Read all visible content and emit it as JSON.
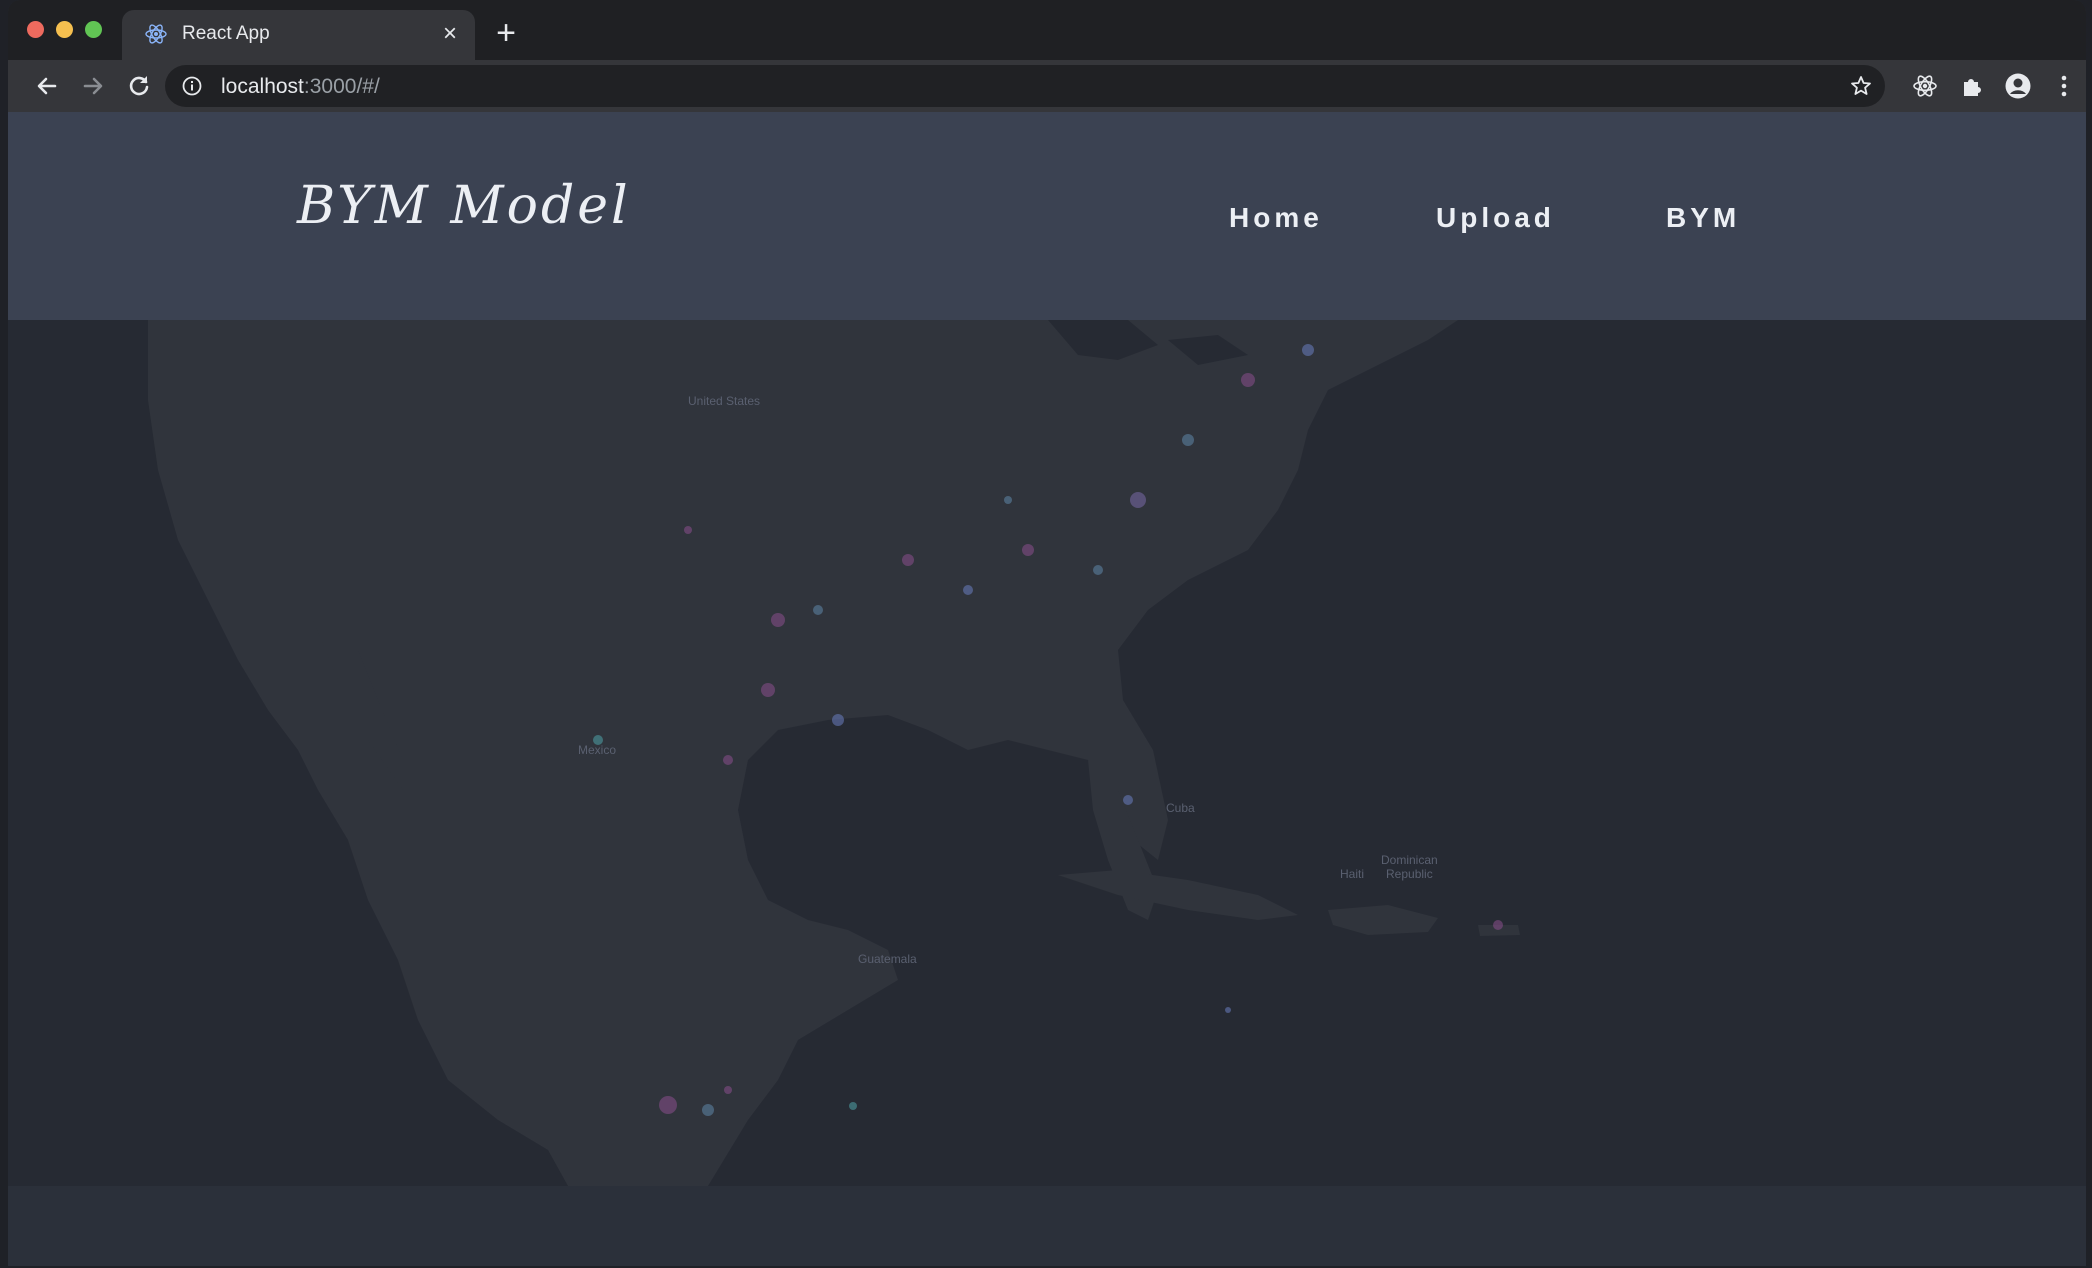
{
  "browser": {
    "tab_title": "React App",
    "close_glyph": "×",
    "new_tab_glyph": "+",
    "url_host": "localhost",
    "url_rest": ":3000/#/"
  },
  "navbar": {
    "brand": "BYM Model",
    "links": [
      {
        "label": "Home"
      },
      {
        "label": "Upload"
      },
      {
        "label": "BYM"
      }
    ]
  },
  "map": {
    "labels": {
      "united_states": "United States",
      "mexico": "Mexico",
      "cuba": "Cuba",
      "dominican_republic_1": "Dominican",
      "dominican_republic_2": "Republic",
      "haiti": "Haiti",
      "guatemala": "Guatemala"
    }
  },
  "colors": {
    "navbar_bg": "#3b4252",
    "page_bg": "#2b303a",
    "map_water": "#262a33",
    "map_land": "#30343c",
    "nav_text": "#eceff4"
  }
}
